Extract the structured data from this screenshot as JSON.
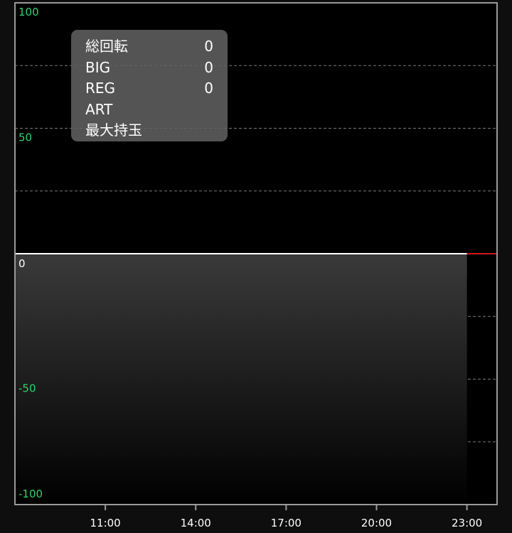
{
  "chart_data": {
    "type": "area",
    "y_ticks": [
      {
        "value": 100,
        "label": "100"
      },
      {
        "value": 50,
        "label": "50"
      },
      {
        "value": 0,
        "label": "0"
      },
      {
        "value": -50,
        "label": "-50"
      },
      {
        "value": -100,
        "label": "-100"
      }
    ],
    "ylim": [
      -100,
      100
    ],
    "x_ticks": [
      "11:00",
      "14:00",
      "17:00",
      "20:00",
      "23:00"
    ],
    "xlim": [
      "08:00",
      "24:00"
    ],
    "series": [
      {
        "x": [
          "08:00",
          "23:00"
        ],
        "values": [
          0,
          0
        ]
      }
    ],
    "current_value": 0,
    "grid": true,
    "grid_style": "dashed",
    "colors": {
      "background": "#000000",
      "frame": "#9a9a9a",
      "grid": "#7a7a7a",
      "y_tick_label": "#2fd36e",
      "zero_label": "#ffffff",
      "x_tick_label": "#ffffff",
      "series_line": "#ffffff",
      "current_line": "#cc1a1a",
      "area_top": "#3a3a3a",
      "area_bottom": "#000000"
    }
  },
  "info_box": {
    "rows": [
      {
        "label": "総回転",
        "value": "0"
      },
      {
        "label": "BIG",
        "value": "0"
      },
      {
        "label": "REG",
        "value": "0"
      },
      {
        "label": "ART",
        "value": ""
      },
      {
        "label": "最大持玉",
        "value": ""
      }
    ]
  }
}
